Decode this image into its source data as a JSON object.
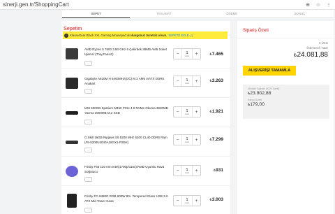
{
  "browser": {
    "url": "sinerji.gen.tr/ShoppingCart"
  },
  "steps": [
    "SEPET",
    "TESLİMAT",
    "ÖDEME",
    "SONUÇ"
  ],
  "cart": {
    "title": "Sepetim",
    "promo": {
      "text_pre": "KlasseGear Black XXL Gaming Mousepad alın ",
      "text_bold": "kargonuz ücretsiz olsun.",
      "link": "SEPETE EKLE"
    },
    "items": [
      {
        "name": "AMD Ryzen 5 7600 3.80 GHz 6 Çekirdek 38MB AM5 Soket İşlemci (Tray,Fansız)",
        "qty": "1",
        "unit": "Adet",
        "price": "7.465",
        "badge": "...",
        "color": "#3a3a3a"
      },
      {
        "name": "Gigabyte A620M H 6400MHz(OC) M.2 AM5 mATX DDR5 Anakart",
        "qty": "1",
        "unit": "Adet",
        "price": "3.263",
        "badge": "...",
        "color": "#2a2a2a"
      },
      {
        "name": "MSI 500GB Spatium M450 PCIe 4.0 NVMe Okuma 3600MB Yazma 3000MB M.2 SSD",
        "qty": "1",
        "unit": "Adet",
        "price": "1.921",
        "badge": "...",
        "color": "#1f1f1f"
      },
      {
        "name": "G.Skill 16GB Ripjaws S5 5200 MHz 5200 CL40 DDR5 Ram (F5-5200U4040A16GX1-RS5K)",
        "qty": "1",
        "unit": "Adet",
        "price": "7.299",
        "badge": "...",
        "color": "#333"
      },
      {
        "name": "Frisby F65 120 mm Intel(1700p/115x)/AMD Uyumlu Hava Soğutucu",
        "qty": "1",
        "unit": "Adet",
        "price": "931",
        "badge": "...",
        "color": "#6b63d6"
      },
      {
        "name": "Frisby FC-9480G RGB 600W 80+ Tempered Glass USB 3.0 ATX Mid Tower Kasa",
        "qty": "1",
        "unit": "Adet",
        "price": "3.003",
        "badge": "...",
        "color": "#222"
      }
    ]
  },
  "summary": {
    "title": "Sipariş Özeti",
    "count": "6 Ürün",
    "payable_label": "Ödenecek Tutar",
    "payable": "24.081,88",
    "checkout": "ALIŞVERİŞİ TAMAMLA",
    "products_label": "Ürünler Toplamı (KDV Dahil)",
    "products_value": "23.902,88",
    "shipping_label": "Kargo Ücreti",
    "shipping_value": "179,00",
    "currency": "₺"
  }
}
